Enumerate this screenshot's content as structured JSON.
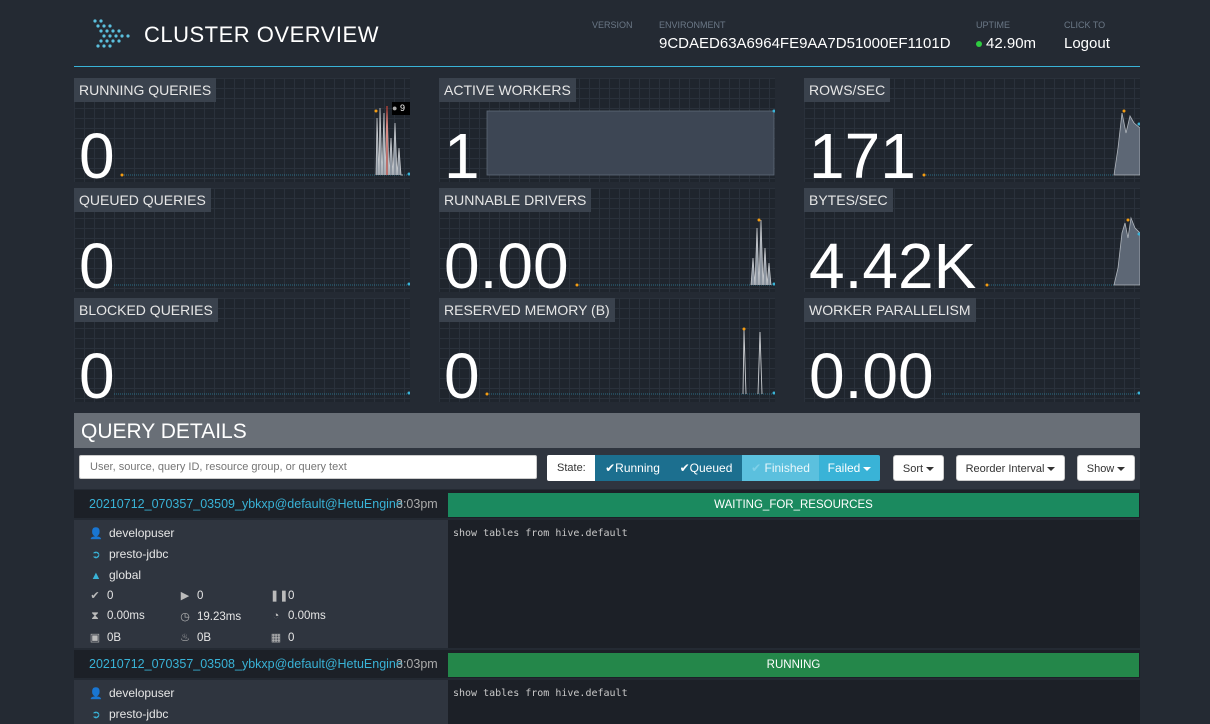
{
  "header": {
    "title": "CLUSTER OVERVIEW",
    "version_label": "VERSION",
    "version_value": "",
    "environment_label": "ENVIRONMENT",
    "environment_value": "9CDAED63A6964FE9AA7D51000EF1101D",
    "uptime_label": "UPTIME",
    "uptime_value": "42.90m",
    "logout_label": "CLICK TO",
    "logout_value": "Logout"
  },
  "tiles": [
    {
      "label": "RUNNING QUERIES",
      "value": "0",
      "tooltip": "9"
    },
    {
      "label": "ACTIVE WORKERS",
      "value": "1"
    },
    {
      "label": "ROWS/SEC",
      "value": "171"
    },
    {
      "label": "QUEUED QUERIES",
      "value": "0"
    },
    {
      "label": "RUNNABLE DRIVERS",
      "value": "0.00"
    },
    {
      "label": "BYTES/SEC",
      "value": "4.42K"
    },
    {
      "label": "BLOCKED QUERIES",
      "value": "0"
    },
    {
      "label": "RESERVED MEMORY (B)",
      "value": "0"
    },
    {
      "label": "WORKER PARALLELISM",
      "value": "0.00"
    }
  ],
  "query_details": {
    "title": "QUERY DETAILS",
    "search_placeholder": "User, source, query ID, resource group, or query text",
    "state_label": "State:",
    "state_buttons": [
      {
        "label": "Running",
        "color": "#1c6f8f"
      },
      {
        "label": "Queued",
        "color": "#1c6f8f"
      },
      {
        "label": "Finished",
        "color": "#5bc0de"
      },
      {
        "label": "Failed",
        "color": "#39b3d7"
      }
    ],
    "sort_label": "Sort",
    "reorder_label": "Reorder Interval",
    "show_label": "Show"
  },
  "queries": [
    {
      "id": "20210712_070357_03509_ybkxp@default@HetuEngine",
      "time": "3:03pm",
      "state": "WAITING_FOR_RESOURCES",
      "sql": "show tables from hive.default",
      "user": "developuser",
      "source": "presto-jdbc",
      "resource_group": "global",
      "completed_splits": "0",
      "running_splits": "0",
      "queued_splits": "0",
      "wall_time": "0.00ms",
      "elapsed_time": "19.23ms",
      "cpu_time": "0.00ms",
      "memory": "0B",
      "peak_memory": "0B",
      "cumulative": "0"
    },
    {
      "id": "20210712_070357_03508_ybkxp@default@HetuEngine",
      "time": "3:03pm",
      "state": "RUNNING",
      "sql": "show tables from hive.default",
      "user": "developuser",
      "source": "presto-jdbc"
    }
  ],
  "colors": {
    "accent": "#39b3d7",
    "waiting": "#1b8a5f",
    "running": "#24874a"
  }
}
